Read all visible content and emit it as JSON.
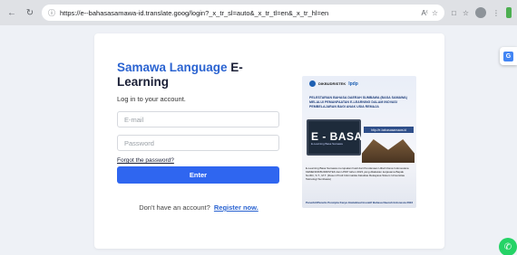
{
  "browser": {
    "url": "https://e--bahasasamawa-id.translate.goog/login?_x_tr_sl=auto&_x_tr_tl=en&_x_tr_hl=en",
    "icons": [
      "back-arrow-icon",
      "reload-icon",
      "site-info-icon",
      "read-aloud-icon",
      "bookmark-star-icon",
      "extensions-icon",
      "favorites-icon",
      "profile-icon"
    ]
  },
  "login": {
    "title_highlight": "Samawa Language",
    "title_rest": " E-Learning",
    "subtitle": "Log in to your account.",
    "email_placeholder": "E-mail",
    "password_placeholder": "Password",
    "forgot": "Forgot the password?",
    "enter": "Enter",
    "no_account": "Don't have an account?",
    "register": "Register now."
  },
  "poster": {
    "heading": "PELESTARIAN BAHASA DAERAH SUMBAWA (BASA SAMAWA) MELALUI PEMANFAATAN E-LEARNING DALAM INOVASI PEMBELAJARAN BAGI ANAK USIA REMAJA",
    "ebasa": "E - BASA",
    "ebasa_sub": "E-Learning Basa Samawa",
    "url": "http://e-bahasasamawa.id",
    "lpdp": "lpdp",
    "org": "DIKBUDRISTEK",
    "description": "E-Learning Basa Samawa merupakan hasil dari Pendanaan Hibah Dana Indonesiana KEMENDIKBUDRISTEK dan LPDP tahun 2023 yang dilakukan kerjasama Bapak Nurfitri, S.T., M.T. (Dosen Prodi Informatika Fakultas Rekayasa Sistem Universitas Teknologi Sumbawa)",
    "footer": "Penerbit/Penulis Pencipta Karya Intelektual Inovatif Bahasa Daerah Indonesia 2023"
  },
  "colors": {
    "accent": "#2f66f0",
    "brand_blue": "#2a63d1",
    "whatsapp": "#25d366"
  }
}
